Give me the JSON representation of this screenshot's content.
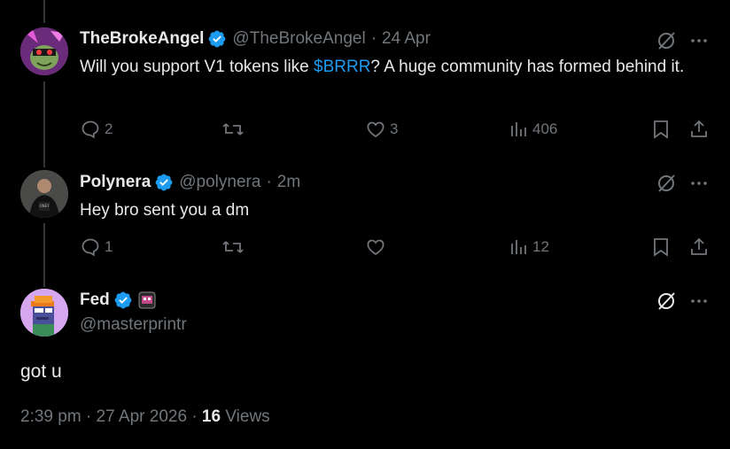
{
  "tweets": [
    {
      "name": "TheBrokeAngel",
      "handle": "@TheBrokeAngel",
      "sep": "·",
      "time": "24 Apr",
      "text_pre": "Will you support V1 tokens like ",
      "text_link": "$BRRR",
      "text_post": "? A huge community has formed behind it.",
      "replies": "2",
      "reposts": "",
      "likes": "3",
      "views": "406"
    },
    {
      "name": "Polynera",
      "handle": "@polynera",
      "sep": "·",
      "time": "2m",
      "text": "Hey bro sent you a dm",
      "replies": "1",
      "reposts": "",
      "likes": "",
      "views": "12"
    }
  ],
  "main": {
    "name": "Fed",
    "handle": "@masterprintr",
    "text": "got u",
    "time": "2:39 pm",
    "sep1": "·",
    "date": "27 Apr 2026",
    "sep2": "·",
    "views_count": "16",
    "views_label": "Views"
  },
  "colors": {
    "accent": "#1d9bf0",
    "muted": "#71767b",
    "text": "#e7e9ea",
    "bg": "#000000"
  }
}
